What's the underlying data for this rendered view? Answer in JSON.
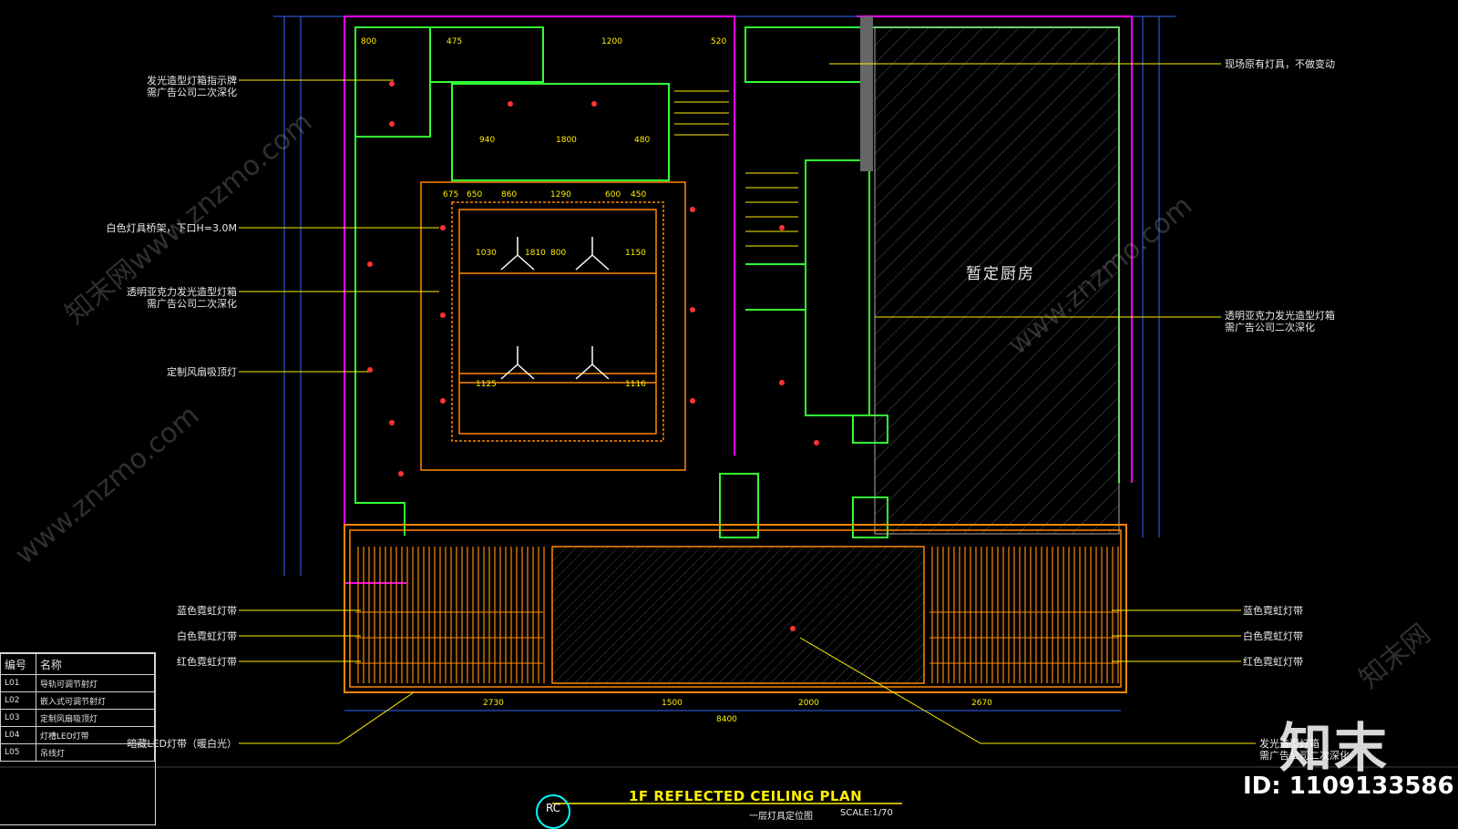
{
  "left_labels": [
    {
      "lines": [
        "发光造型灯箱指示牌",
        "需广告公司二次深化"
      ]
    },
    {
      "lines": [
        "白色灯具桥架，下口H=3.0M"
      ]
    },
    {
      "lines": [
        "透明亚克力发光造型灯箱",
        "需广告公司二次深化"
      ]
    },
    {
      "lines": [
        "定制风扇吸顶灯"
      ]
    },
    {
      "lines": [
        "蓝色霓虹灯带"
      ]
    },
    {
      "lines": [
        "白色霓虹灯带"
      ]
    },
    {
      "lines": [
        "红色霓虹灯带"
      ]
    },
    {
      "lines": [
        "暗藏LED灯带（暖白光）"
      ]
    }
  ],
  "right_labels": [
    {
      "lines": [
        "现场原有灯具，不做变动"
      ]
    },
    {
      "lines": [
        "透明亚克力发光造型灯箱",
        "需广告公司二次深化"
      ]
    },
    {
      "lines": [
        "蓝色霓虹灯带"
      ]
    },
    {
      "lines": [
        "白色霓虹灯带"
      ]
    },
    {
      "lines": [
        "红色霓虹灯带"
      ]
    },
    {
      "lines": [
        "发光造型灯箱",
        "需广告公司二次深化"
      ]
    }
  ],
  "room_label": "暂定厨房",
  "legend": {
    "header": [
      "编号",
      "名称"
    ],
    "rows": [
      [
        "L01",
        "导轨可调节射灯"
      ],
      [
        "L02",
        "嵌入式可调节射灯"
      ],
      [
        "L03",
        "定制风扇吸顶灯"
      ],
      [
        "L04",
        "灯槽LED灯带"
      ],
      [
        "L05",
        "吊线灯"
      ]
    ]
  },
  "title": {
    "badge": "RC",
    "main": "1F REFLECTED CEILING PLAN",
    "sub": "一层灯具定位图",
    "scale": "SCALE:1/70"
  },
  "dimensions_top": [
    "800",
    "475",
    "1200",
    "520",
    "940",
    "1800",
    "480",
    "675",
    "650",
    "860",
    "1290",
    "600",
    "450"
  ],
  "dimensions_mid": [
    "1030",
    "1810",
    "800",
    "1150",
    "1125",
    "1116"
  ],
  "dimensions_bottom": [
    "8400",
    "2730",
    "1500",
    "2000",
    "2670"
  ],
  "watermarks": [
    "知末网www.znzmo.com",
    "www.znzmo.com",
    "知末网"
  ],
  "logo": "知末",
  "image_id": "ID: 1109133586",
  "colors": {
    "background": "#000000",
    "magenta": "#ff00ff",
    "green": "#33ff33",
    "cyan": "#00ffff",
    "yellow": "#ffee00",
    "orange": "#ff8800",
    "red": "#ff3333",
    "blue": "#3366ff",
    "white": "#dddddd"
  }
}
